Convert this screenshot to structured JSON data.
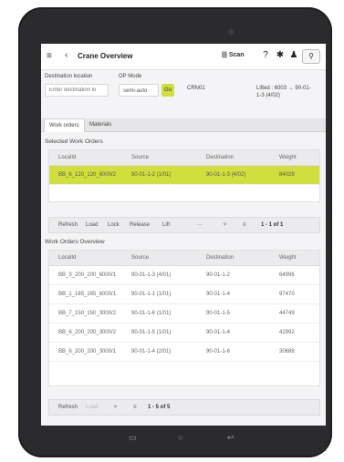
{
  "header": {
    "menu_icon": "hamburger-menu-icon",
    "back_icon": "chevron-left-icon",
    "title": "Crane Overview",
    "scan_label": "Scan",
    "icons": [
      "barcode-icon",
      "help-icon",
      "gear-icon",
      "user-icon",
      "search-icon"
    ],
    "glyphs": {
      "menu": "≡",
      "back": "‹",
      "barcode": "|||",
      "help": "?",
      "gear": "✱",
      "user": "♟",
      "search": "⚲"
    }
  },
  "filters": {
    "destination_label": "Destination location",
    "destination_placeholder": "Enter destination lo",
    "op_mode_label": "OP Mode",
    "op_mode_value": "semi-auto",
    "go_label": "Go",
    "crane_id": "CRN01",
    "lifted_label": "Lifted : 6003 → 90-01-",
    "lifted_value": "1-3 (4/02)"
  },
  "tabs": [
    {
      "label": "Work orders",
      "active": true
    },
    {
      "label": "Materials",
      "active": false
    }
  ],
  "selected": {
    "title": "Selected Work Orders",
    "columns": [
      "LocalId",
      "Source",
      "Destination",
      "Weight"
    ],
    "rows": [
      {
        "local_id": "BB_6_120_120_6000/2",
        "source": "90-01-1-2 (1/01)",
        "destination": "90-01-1-3 (4/02)",
        "weight": "84029",
        "selected": true
      }
    ],
    "toolbar": {
      "refresh": "Refresh",
      "load": "Load",
      "lock": "Lock",
      "release": "Release",
      "lift": "Lift",
      "more": "···",
      "count": "1 - 1 of 1"
    }
  },
  "overview": {
    "title": "Work Orders Overview",
    "columns": [
      "LocalId",
      "Source",
      "Destination",
      "Weight"
    ],
    "rows": [
      {
        "local_id": "BB_3_200_200_6000/1",
        "source": "90-01-1-3 (4/01)",
        "destination": "90-01-1-2",
        "weight": "64996"
      },
      {
        "local_id": "BB_1_165_165_6000/1",
        "source": "90-01-1-1 (1/01)",
        "destination": "90-01-1-4",
        "weight": "97470"
      },
      {
        "local_id": "BB_7_150_150_3000/2",
        "source": "90-01-1-6 (1/01)",
        "destination": "90-01-1-5",
        "weight": "44749"
      },
      {
        "local_id": "BB_6_200_200_3000/2",
        "source": "90-01-1-5 (1/01)",
        "destination": "90-01-1-4",
        "weight": "42992"
      },
      {
        "local_id": "BB_6_200_200_3000/1",
        "source": "90-01-1-4 (2/01)",
        "destination": "90-01-1-6",
        "weight": "30688"
      }
    ],
    "toolbar": {
      "refresh": "Refresh",
      "load": "Load",
      "count": "1 - 5 of 5"
    }
  },
  "toolbar_icons": {
    "settings": "gear-icon",
    "list": "list-icon",
    "settings_glyph": "✧",
    "list_glyph": "≡"
  },
  "device_nav": {
    "recents": "recents-icon",
    "home": "home-icon",
    "back": "back-icon",
    "recents_glyph": "▭",
    "home_glyph": "○",
    "back_glyph": "↩"
  },
  "colors": {
    "accent": "#cfe03c",
    "device": "#2b2b2d"
  }
}
